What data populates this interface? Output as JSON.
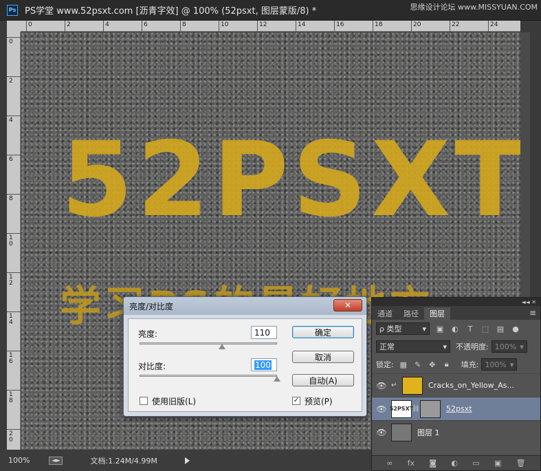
{
  "window": {
    "title": "PS学堂 www.52psxt.com [沥青字效] @ 100% (52psxt, 图层蒙版/8) *",
    "logo": "Ps",
    "watermark": "思缘设计论坛 www.MISSYUAN.COM"
  },
  "rulers": {
    "h_ticks": [
      "0",
      "2",
      "4",
      "6",
      "8",
      "10",
      "12",
      "14",
      "16",
      "18",
      "20",
      "22",
      "24"
    ],
    "v_ticks": [
      "0",
      "2",
      "4",
      "6",
      "8",
      "1\n0",
      "1\n2",
      "1\n4",
      "1\n6",
      "1\n8",
      "2\n0"
    ]
  },
  "canvas": {
    "headline": "52PSXT",
    "subline": "学习PS的最好地方"
  },
  "status": {
    "zoom": "100%",
    "doc_info": "文档:1.24M/4.99M"
  },
  "layers_panel": {
    "tabs": [
      "通道",
      "路径",
      "图层"
    ],
    "active_tab": "图层",
    "filter_label": "ρ 类型",
    "blend_mode": "正常",
    "opacity_label": "不透明度:",
    "opacity_value": "100%",
    "lock_label": "锁定:",
    "fill_label": "填充:",
    "fill_value": "100%",
    "layers": [
      {
        "name": "Cracks_on_Yellow_As...",
        "visible": true,
        "clipped": true,
        "selected": false
      },
      {
        "name": "52psxt",
        "visible": true,
        "clipped": false,
        "selected": true,
        "thumb_text": "52PSXT"
      },
      {
        "name": "图层 1",
        "visible": true,
        "clipped": false,
        "selected": false
      }
    ]
  },
  "dialog": {
    "title": "亮度/对比度",
    "close": "✕",
    "brightness_label": "亮度:",
    "brightness_value": "110",
    "brightness_level": 0.6,
    "contrast_label": "对比度:",
    "contrast_value": "100",
    "contrast_level": 1.0,
    "legacy_label": "使用旧版(L)",
    "legacy_checked": false,
    "ok_label": "确定",
    "cancel_label": "取消",
    "auto_label": "自动(A)",
    "preview_label": "预览(P)",
    "preview_checked": true
  },
  "colors": {
    "paint_yellow": "#d4a81e",
    "selected_layer": "#6f7f99",
    "close_red": "#c4402a"
  }
}
